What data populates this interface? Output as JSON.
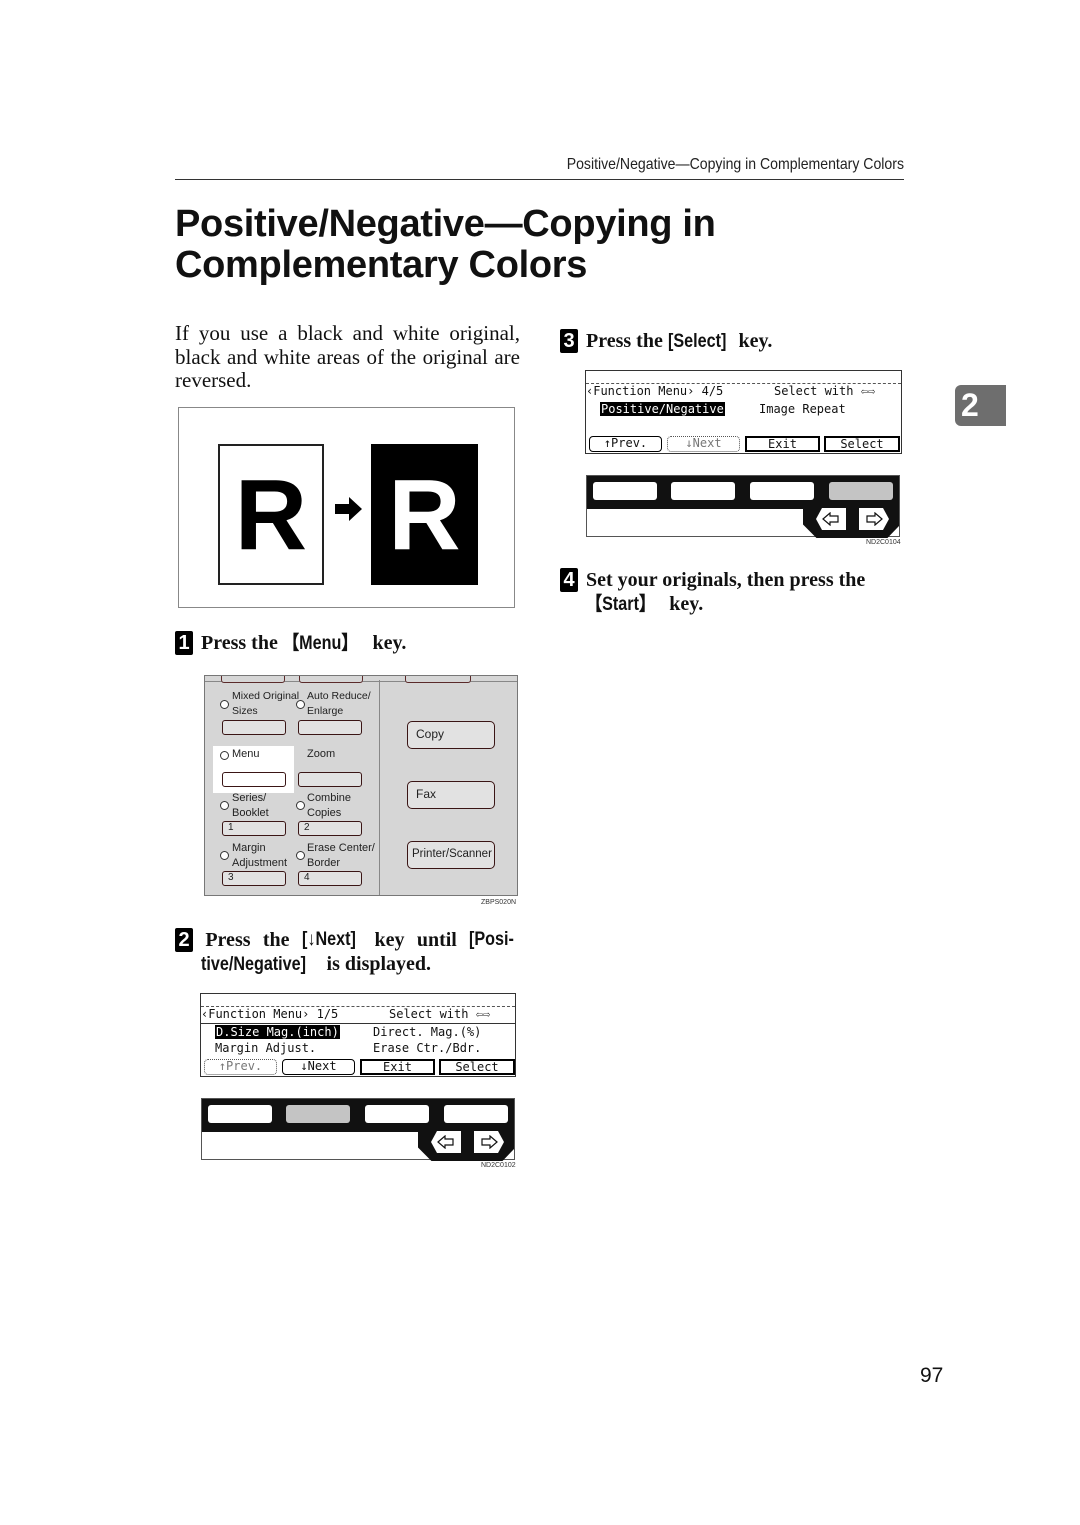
{
  "running_header": "Positive/Negative—Copying in Complementary Colors",
  "title_line1": "Positive/Negative—Copying in",
  "title_line2": "Complementary Colors",
  "intro": "If you use a black and white original, black and white areas of the original are reversed.",
  "illustration": {
    "original_letter": "R",
    "reversed_letter": "R",
    "arrow_icon": "right-arrow-icon"
  },
  "steps": [
    {
      "number": "1",
      "prefix": "Press the ",
      "key": "【Menu】",
      "suffix": " key."
    },
    {
      "number": "2",
      "line1_words": [
        "Press",
        "the",
        "[↓Next]",
        "key",
        "until",
        "[Posi-"
      ],
      "line2_key": "tive/Negative]",
      "line2_suffix": " is displayed."
    },
    {
      "number": "3",
      "prefix": "Press the ",
      "key": "[Select]",
      "suffix": " key."
    },
    {
      "number": "4",
      "line1": "Set your originals, then press the",
      "key": "【Start】",
      "suffix": " key."
    }
  ],
  "control_panel": {
    "keys": [
      {
        "label_line1": "Mixed Original",
        "label_line2": "Sizes",
        "key_text": ""
      },
      {
        "label_line1": "Auto Reduce/",
        "label_line2": "Enlarge",
        "key_text": ""
      },
      {
        "label_line1": "Menu",
        "label_line2": "",
        "key_text": ""
      },
      {
        "label_line1": "Zoom",
        "label_line2": "",
        "key_text": ""
      },
      {
        "label_line1": "Series/",
        "label_line2": "Booklet",
        "key_text": "1"
      },
      {
        "label_line1": "Combine",
        "label_line2": "Copies",
        "key_text": "2"
      },
      {
        "label_line1": "Margin",
        "label_line2": "Adjustment",
        "key_text": "3"
      },
      {
        "label_line1": "Erase Center/",
        "label_line2": "Border",
        "key_text": "4"
      }
    ],
    "mode_keys": [
      "Copy",
      "Fax",
      "Printer/Scanner"
    ],
    "figure_code": "ZBPS020N"
  },
  "lcd_step2": {
    "header_left": "‹Function Menu› 1/5",
    "header_right": "Select with ⇦⇨",
    "row1_left": "D.Size Mag.(inch)",
    "row1_right": "Direct. Mag.(%)",
    "row2_left": "Margin Adjust.",
    "row2_right": "Erase Ctr./Bdr.",
    "buttons": [
      "↑Prev.",
      "↓Next",
      "Exit",
      "Select"
    ],
    "figure_code": "ND2C0102"
  },
  "lcd_step3": {
    "header_left": "‹Function Menu› 4/5",
    "header_right": "Select with ⇦⇨",
    "row1_left": "Positive/Negative",
    "row1_right": "Image Repeat",
    "buttons": [
      "↑Prev.",
      "↓Next",
      "Exit",
      "Select"
    ],
    "figure_code": "ND2C0104"
  },
  "chapter_tab": "2",
  "page_number": "97"
}
